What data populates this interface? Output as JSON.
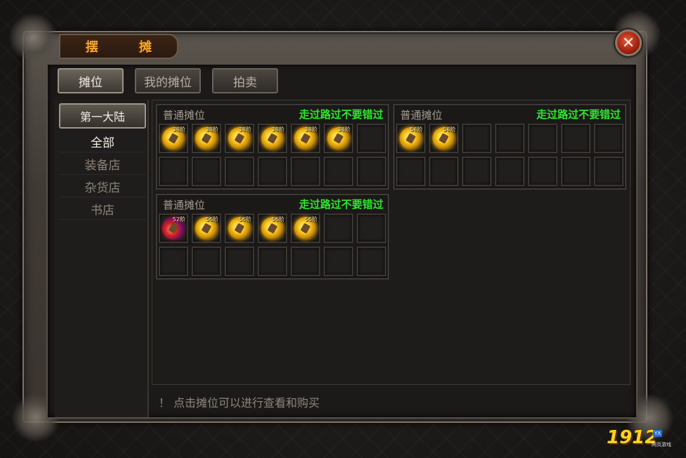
{
  "window": {
    "title": "摆 摊",
    "close_icon": "close-icon"
  },
  "tabs": [
    {
      "label": "摊位",
      "active": true
    },
    {
      "label": "我的摊位",
      "active": false
    },
    {
      "label": "拍卖",
      "active": false
    }
  ],
  "sidebar": {
    "region": "第一大陆",
    "categories": [
      {
        "label": "全部",
        "active": true
      },
      {
        "label": "装备店",
        "active": false
      },
      {
        "label": "杂货店",
        "active": false
      },
      {
        "label": "书店",
        "active": false
      }
    ]
  },
  "stalls": [
    {
      "name": "普通摊位",
      "slogan": "走过路过不要错过",
      "items": [
        {
          "icon": "gold-orb-icon",
          "level": "38阶"
        },
        {
          "icon": "gold-orb-icon",
          "level": "38阶"
        },
        {
          "icon": "gold-orb-icon",
          "level": "38阶"
        },
        {
          "icon": "gold-orb-icon",
          "level": "38阶"
        },
        {
          "icon": "gold-orb-icon",
          "level": "38阶"
        },
        {
          "icon": "gold-orb-icon",
          "level": "38阶"
        }
      ]
    },
    {
      "name": "普通摊位",
      "slogan": "走过路过不要错过",
      "items": [
        {
          "icon": "gold-orb-icon",
          "level": "58阶"
        },
        {
          "icon": "gold-orb-icon",
          "level": "58阶"
        }
      ]
    },
    {
      "name": "普通摊位",
      "slogan": "走过路过不要错过",
      "items": [
        {
          "icon": "red-orb-icon",
          "level": "52阶"
        },
        {
          "icon": "gold-orb-icon",
          "level": "56阶"
        },
        {
          "icon": "gold-orb-icon",
          "level": "56阶"
        },
        {
          "icon": "gold-orb-icon",
          "level": "56阶"
        },
        {
          "icon": "gold-orb-icon",
          "level": "56阶"
        }
      ]
    }
  ],
  "hint": "！ 点击摊位可以进行查看和购买",
  "watermark": {
    "brand": "1912",
    "tag": "YX",
    "sub": "网页游戏"
  }
}
